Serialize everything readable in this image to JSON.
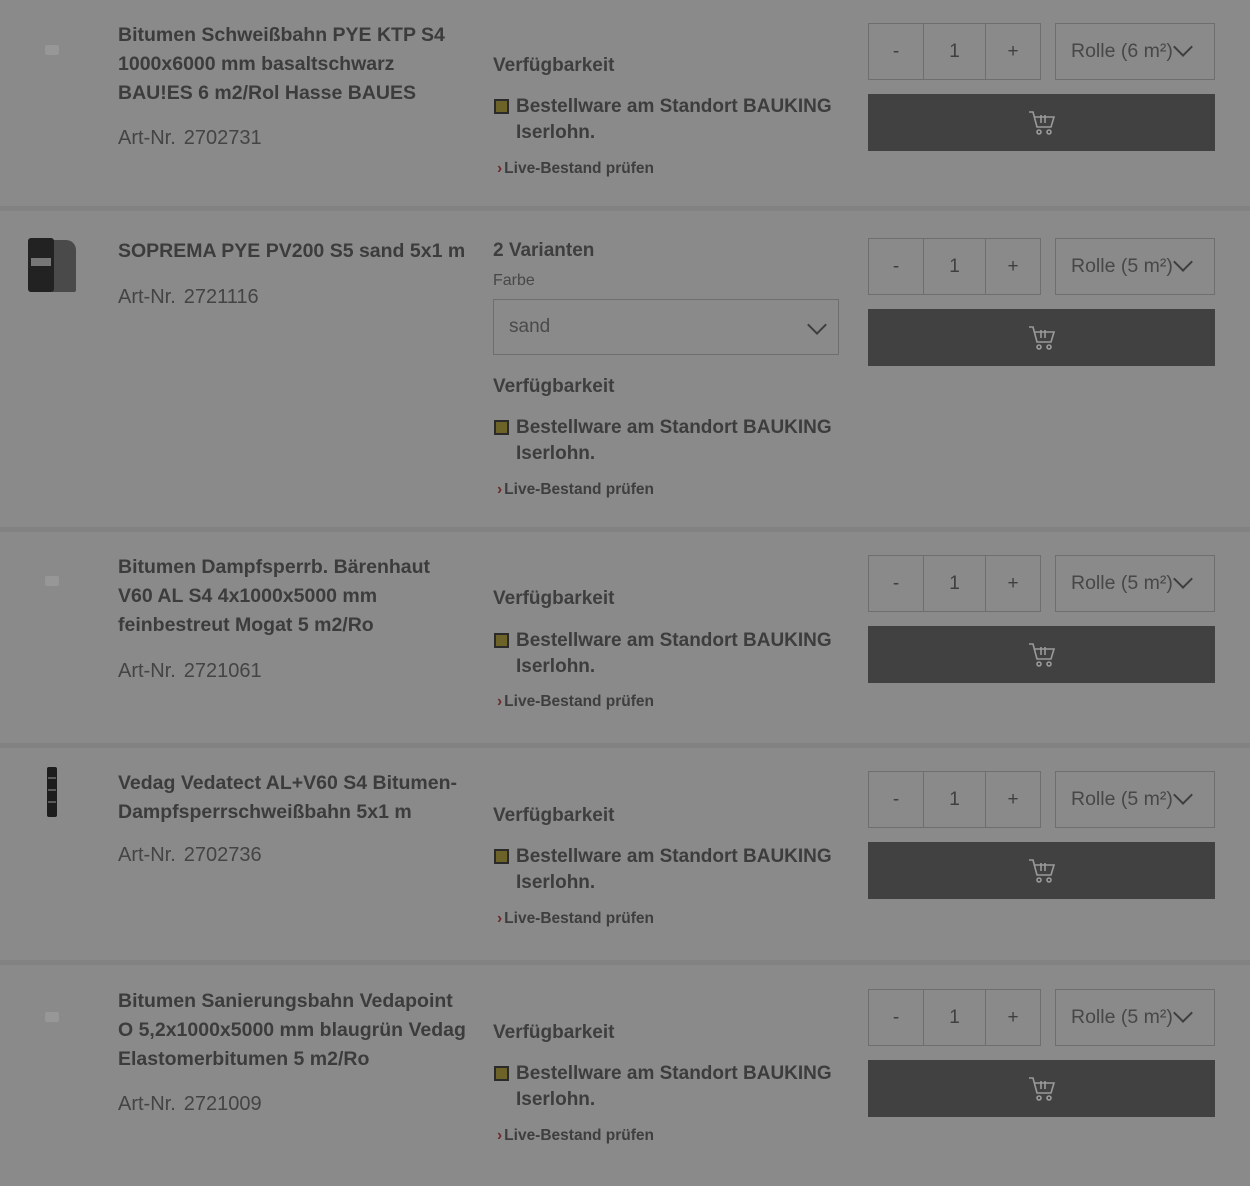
{
  "products": [
    {
      "title": "Bitumen Schweißbahn PYE KTP S4 1000x6000 mm basaltschwarz BAU!ES 6 m2/Rol Hasse BAUES",
      "art_label": "Art-Nr.",
      "art_nr": "2702731",
      "availability_heading": "Verfügbarkeit",
      "availability_text": "Bestellware am Standort BAUKING Iserlohn.",
      "live_stock": "Live-Bestand prüfen",
      "qty_minus": "-",
      "qty_value": "1",
      "qty_plus": "+",
      "unit": "Rolle (6 m²)",
      "image": "placeholder"
    },
    {
      "title": "SOPREMA PYE PV200 S5 sand 5x1 m",
      "art_label": "Art-Nr.",
      "art_nr": "2721116",
      "variants": "2 Varianten",
      "color_label": "Farbe",
      "color_value": "sand",
      "availability_heading": "Verfügbarkeit",
      "availability_text": "Bestellware am Standort BAUKING Iserlohn.",
      "live_stock": "Live-Bestand prüfen",
      "qty_minus": "-",
      "qty_value": "1",
      "qty_plus": "+",
      "unit": "Rolle (5 m²)",
      "image": "roll"
    },
    {
      "title": "Bitumen Dampfsperrb. Bärenhaut V60 AL S4 4x1000x5000 mm feinbestreut Mogat 5 m2/Ro",
      "art_label": "Art-Nr.",
      "art_nr": "2721061",
      "availability_heading": "Verfügbarkeit",
      "availability_text": "Bestellware am Standort BAUKING Iserlohn.",
      "live_stock": "Live-Bestand prüfen",
      "qty_minus": "-",
      "qty_value": "1",
      "qty_plus": "+",
      "unit": "Rolle (5 m²)",
      "image": "placeholder"
    },
    {
      "title": "Vedag Vedatect AL+V60 S4 Bitumen-Dampfsperrschweißbahn 5x1 m",
      "art_label": "Art-Nr.",
      "art_nr": "2702736",
      "availability_heading": "Verfügbarkeit",
      "availability_text": "Bestellware am Standort BAUKING Iserlohn.",
      "live_stock": "Live-Bestand prüfen",
      "qty_minus": "-",
      "qty_value": "1",
      "qty_plus": "+",
      "unit": "Rolle (5 m²)",
      "image": "strip"
    },
    {
      "title": "Bitumen Sanierungsbahn Vedapoint O 5,2x1000x5000 mm blaugrün Vedag Elastomerbitumen 5 m2/Ro",
      "art_label": "Art-Nr.",
      "art_nr": "2721009",
      "availability_heading": "Verfügbarkeit",
      "availability_text": "Bestellware am Standort BAUKING Iserlohn.",
      "live_stock": "Live-Bestand prüfen",
      "qty_minus": "-",
      "qty_value": "1",
      "qty_plus": "+",
      "unit": "Rolle (5 m²)",
      "image": "placeholder"
    }
  ],
  "icons": {
    "cart": "cart-icon",
    "chevron": "chevron-down-icon",
    "live_stock": "chevron-right-icon",
    "stock_status": "stock-status-icon"
  },
  "colors": {
    "overlay_background": "#8a8a8a",
    "cart_button": "#414141",
    "stock_square": "#6d6329",
    "live_chevron": "#6e2a2a"
  }
}
